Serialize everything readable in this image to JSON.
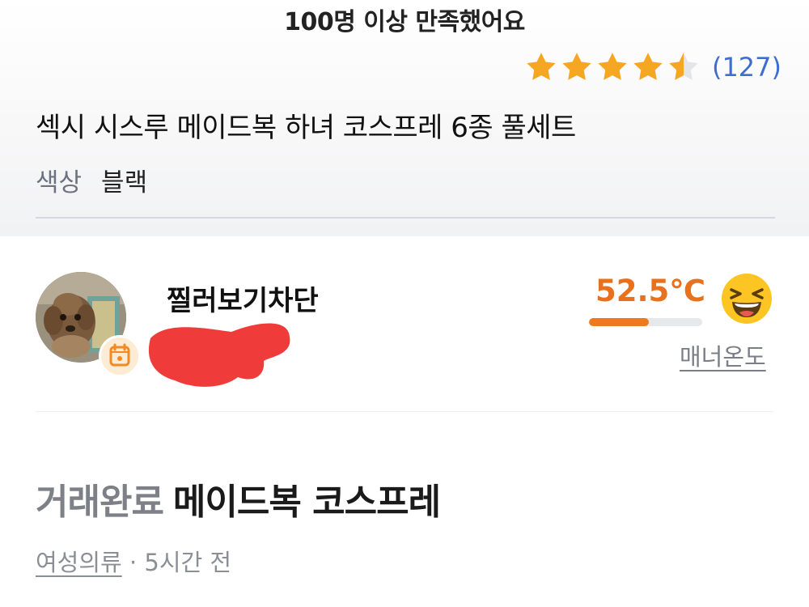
{
  "product": {
    "satisfaction_text": "100명 이상 만족했어요",
    "rating": 4.5,
    "review_count": "(127)",
    "title": "섹시 시스루 메이드복 하녀 코스프레 6종 풀세트",
    "option_label": "색상",
    "option_value": "블랙",
    "star_color": "#f5a623"
  },
  "seller": {
    "name": "찔러보기차단",
    "temperature": "52.5℃",
    "temperature_level": 0.525,
    "manner_label": "매너온도",
    "accent_color": "#e8711d"
  },
  "article": {
    "status": "거래완료",
    "title": "메이드복 코스프레",
    "category": "여성의류",
    "separator": " · ",
    "time": "5시간 전"
  }
}
